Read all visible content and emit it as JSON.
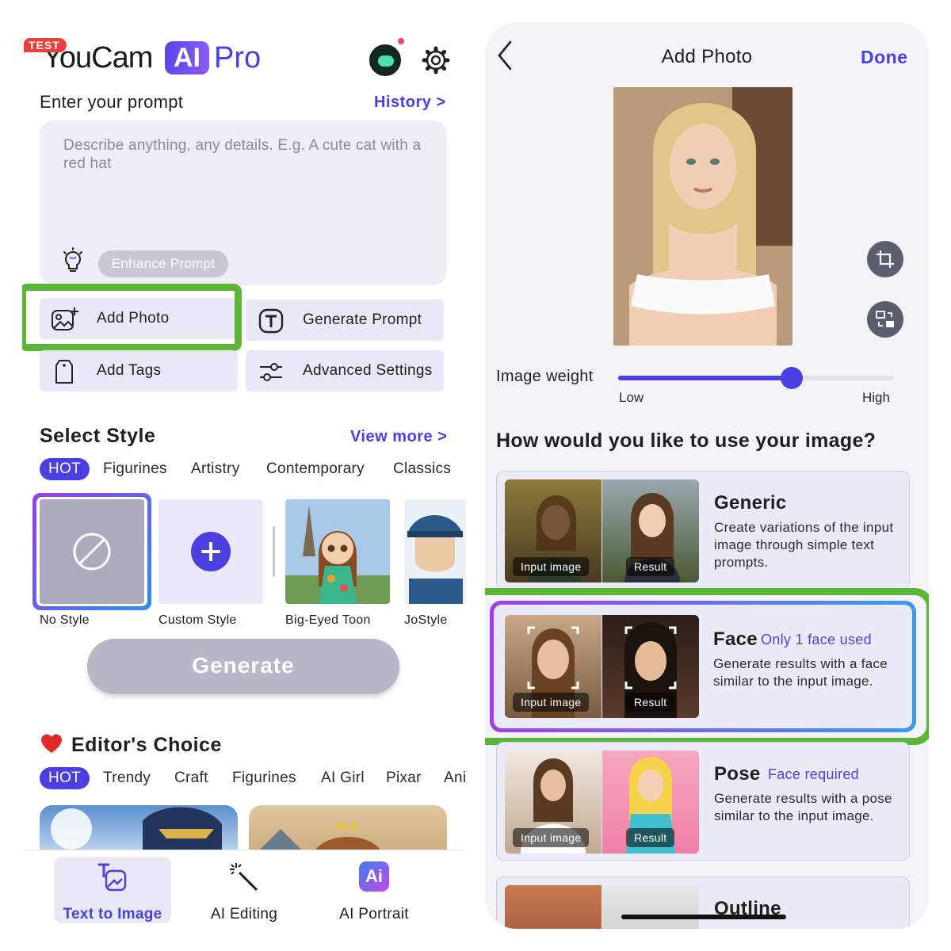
{
  "left": {
    "logo": {
      "badge": "TEST",
      "brand": "YouCam",
      "ai": "AI",
      "pro": "Pro"
    },
    "prompt": {
      "title": "Enter your prompt",
      "history_link": "History >",
      "placeholder": "Describe anything, any details. E.g. A cute cat with a red hat",
      "enhance_label": "Enhance Prompt"
    },
    "actions": {
      "add_photo": "Add Photo",
      "generate_prompt": "Generate Prompt",
      "add_tags": "Add Tags",
      "advanced_settings": "Advanced Settings"
    },
    "select_style": {
      "title": "Select Style",
      "view_more": "View more >",
      "tabs": [
        "HOT",
        "Figurines",
        "Artistry",
        "Contemporary",
        "Classics"
      ],
      "active_tab": "HOT",
      "styles": [
        "No Style",
        "Custom Style",
        "Big-Eyed Toon",
        "JoStyle"
      ],
      "selected_style": "No Style"
    },
    "generate_label": "Generate",
    "editors_choice": {
      "title": "Editor's Choice",
      "tabs": [
        "HOT",
        "Trendy",
        "Craft",
        "Figurines",
        "AI Girl",
        "Pixar",
        "Ani"
      ],
      "active_tab": "HOT"
    },
    "bottom_nav": {
      "items": [
        "Text to Image",
        "AI Editing",
        "AI Portrait"
      ],
      "active": "Text to Image"
    }
  },
  "right": {
    "header": {
      "title": "Add Photo",
      "done": "Done"
    },
    "image_weight": {
      "label": "Image weight",
      "low": "Low",
      "high": "High",
      "value": 0.63
    },
    "question": "How would you like to use your image?",
    "options": [
      {
        "title": "Generic",
        "subtitle": "",
        "desc": "Create variations of the input image through simple text prompts.",
        "input_tag": "Input image",
        "result_tag": "Result"
      },
      {
        "title": "Face",
        "subtitle": "Only 1 face used",
        "desc": "Generate results with a face similar to the input image.",
        "input_tag": "Input image",
        "result_tag": "Result"
      },
      {
        "title": "Pose",
        "subtitle": "Face required",
        "desc": "Generate results with a pose similar to the input image.",
        "input_tag": "Input image",
        "result_tag": "Result"
      },
      {
        "title": "Outline",
        "subtitle": "",
        "desc": "",
        "input_tag": "",
        "result_tag": ""
      }
    ],
    "selected_option": "Face"
  },
  "colors": {
    "accent": "#4b3fe0",
    "highlight_frame": "#5bb537",
    "test_badge": "#e8403d"
  }
}
